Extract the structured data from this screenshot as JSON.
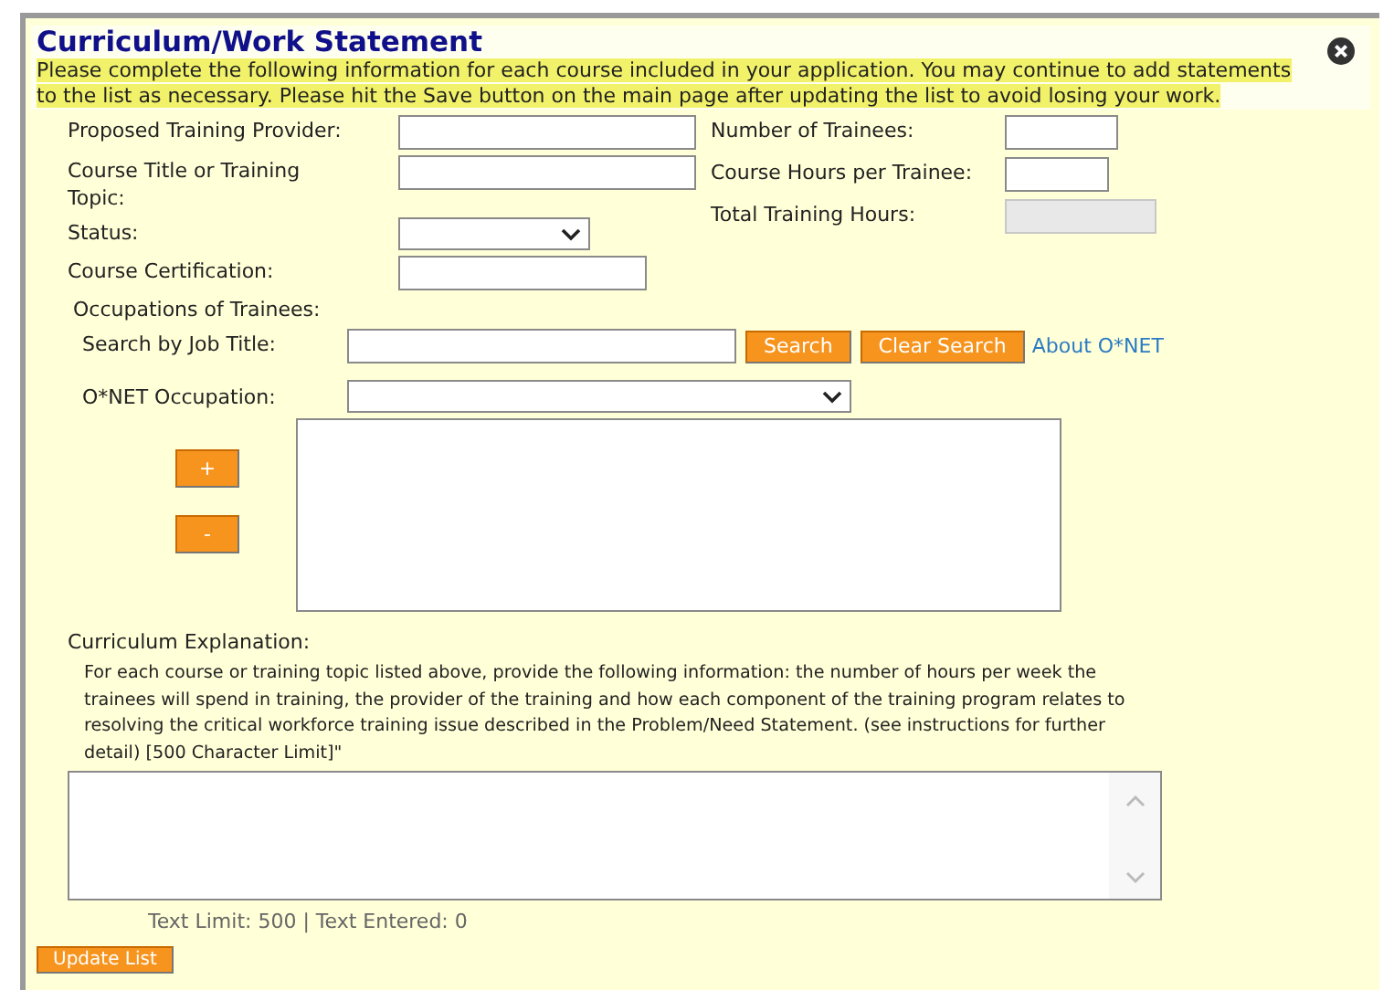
{
  "dialog": {
    "title": "Curriculum/Work Statement",
    "instructions": "Please complete the following information for each course included in your application. You may continue to add statements to the list as necessary. Please hit the Save button on the main page after updating the list to avoid losing your work."
  },
  "left_fields": [
    {
      "label": "Proposed Training Provider:",
      "kind": "text",
      "disabled": false
    },
    {
      "label": "Course Title or Training Topic:",
      "kind": "text",
      "disabled": false
    },
    {
      "label": "Status:",
      "kind": "select",
      "disabled": false
    },
    {
      "label": "Course Certification:",
      "kind": "text",
      "disabled": false
    }
  ],
  "right_fields": [
    {
      "label": "Number of Trainees:",
      "kind": "text",
      "disabled": false
    },
    {
      "label": "Course Hours per Trainee:",
      "kind": "text",
      "disabled": false
    },
    {
      "label": "Total Training Hours:",
      "kind": "text",
      "disabled": true
    }
  ],
  "occupations": {
    "heading": "Occupations of Trainees:",
    "search_label": "Search by Job Title:",
    "search_button": "Search",
    "clear_button": "Clear Search",
    "about_link": "About O*NET",
    "occupation_label": "O*NET Occupation:",
    "add_button": "+",
    "remove_button": "-"
  },
  "explanation": {
    "heading": "Curriculum Explanation:",
    "description": "For each course or training topic listed above, provide the following information: the number of hours per week the trainees will spend in training, the provider of the training and how each component of the training program relates to resolving the critical workforce training issue described in the Problem/Need Statement. (see instructions for further detail) [500 Character Limit]\"",
    "counter": "Text Limit: 500 | Text Entered: 0"
  },
  "update_button": "Update List"
}
